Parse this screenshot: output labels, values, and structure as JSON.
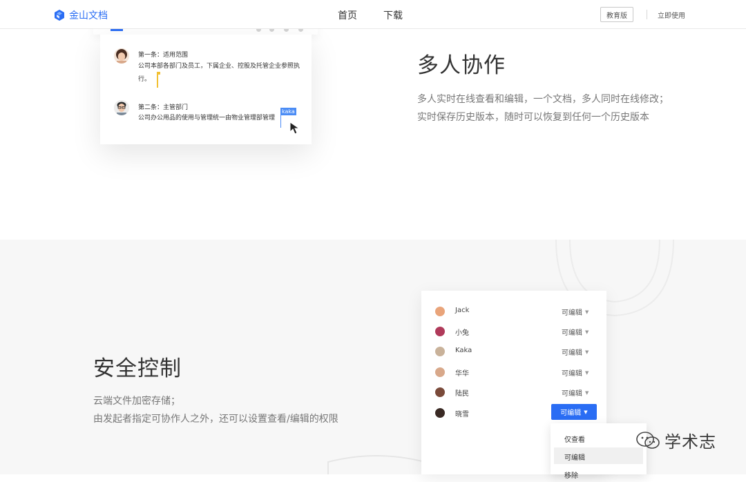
{
  "header": {
    "logo_text": "金山文档",
    "nav": [
      "首页",
      "下载"
    ],
    "edu_label": "教育版",
    "use_label": "立即使用"
  },
  "collab": {
    "title": "多人协作",
    "desc_line1": "多人实时在线查看和编辑，一个文档，多人同时在线修改；",
    "desc_line2": "实时保存历史版本，随时可以恢复到任何一个历史版本",
    "comments": [
      {
        "title": "第一条：适用范围",
        "text": "公司本部各部门及员工，下属企业、控股及托管企业参照执行。"
      },
      {
        "title": "第二条：主管部门",
        "text": "公司办公用品的使用与管理统一由物业管理部管理"
      }
    ],
    "cursor_tag": "kaka"
  },
  "security": {
    "title": "安全控制",
    "desc_line1": "云端文件加密存储；",
    "desc_line2": "由发起者指定可协作人之外，还可以设置查看/编辑的权限",
    "members": [
      {
        "name": "Jack",
        "role": "可编辑"
      },
      {
        "name": "小兔",
        "role": "可编辑"
      },
      {
        "name": "Kaka",
        "role": "可编辑"
      },
      {
        "name": "华华",
        "role": "可编辑"
      },
      {
        "name": "陆民",
        "role": "可编辑"
      },
      {
        "name": "晓雪",
        "role": "可编辑"
      }
    ],
    "dropdown": [
      "仅查看",
      "可编辑",
      "移除"
    ]
  },
  "watermark": "学术志",
  "colors": {
    "brand_blue": "#2a6df4",
    "caret_yellow": "#f2c033",
    "section_bg": "#f7f7f7"
  }
}
